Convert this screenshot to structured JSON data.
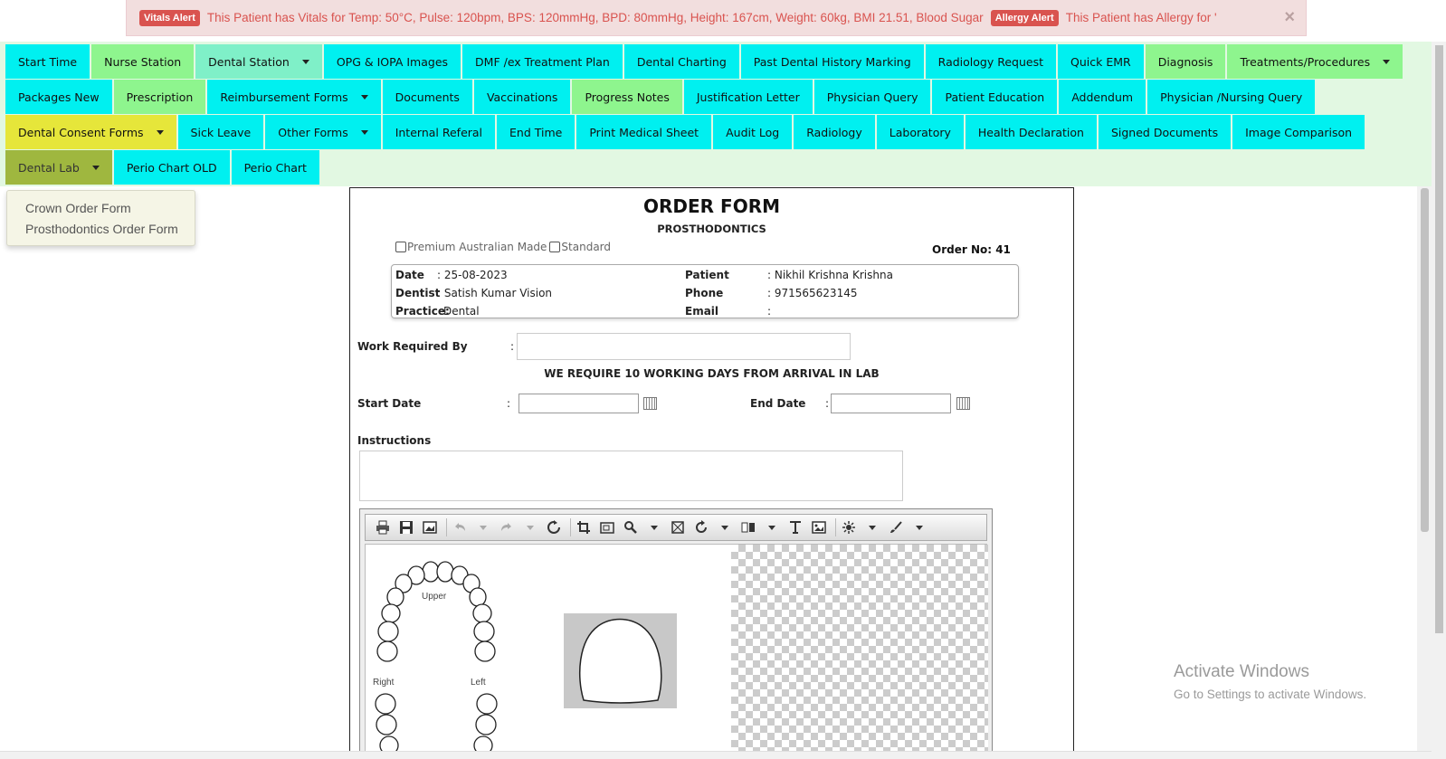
{
  "alerts": {
    "vitals_badge": "Vitals Alert",
    "vitals_text": "This Patient has Vitals for Temp: 50°C, Pulse: 120bpm, BPS: 120mmHg, BPD: 80mmHg, Height: 167cm, Weight: 60kg, BMI 21.51, Blood Sugar",
    "allergy_badge": "Allergy Alert",
    "allergy_text": "This Patient has Allergy for '",
    "close": "×"
  },
  "nav": {
    "row1": [
      {
        "label": "Start Time",
        "color": "cyan",
        "caret": false
      },
      {
        "label": "Nurse Station",
        "color": "green",
        "caret": false
      },
      {
        "label": "Dental Station",
        "color": "mint",
        "caret": true
      },
      {
        "label": "OPG & IOPA Images",
        "color": "cyan",
        "caret": false
      },
      {
        "label": "DMF /ex Treatment Plan",
        "color": "cyan",
        "caret": false
      },
      {
        "label": "Dental Charting",
        "color": "cyan",
        "caret": false
      },
      {
        "label": "Past Dental History Marking",
        "color": "cyan",
        "caret": false
      },
      {
        "label": "Radiology Request",
        "color": "cyan",
        "caret": false
      },
      {
        "label": "Quick EMR",
        "color": "cyan",
        "caret": false
      },
      {
        "label": "Diagnosis",
        "color": "green",
        "caret": false
      },
      {
        "label": "Treatments/Procedures",
        "color": "green",
        "caret": true
      }
    ],
    "row2": [
      {
        "label": "Packages New",
        "color": "cyan",
        "caret": false
      },
      {
        "label": "Prescription",
        "color": "green",
        "caret": false
      },
      {
        "label": "Reimbursement Forms",
        "color": "cyan",
        "caret": true
      },
      {
        "label": "Documents",
        "color": "cyan",
        "caret": false
      },
      {
        "label": "Vaccinations",
        "color": "cyan",
        "caret": false
      },
      {
        "label": "Progress Notes",
        "color": "green",
        "caret": false
      },
      {
        "label": "Justification Letter",
        "color": "cyan",
        "caret": false
      },
      {
        "label": "Physician Query",
        "color": "cyan",
        "caret": false
      },
      {
        "label": "Patient Education",
        "color": "cyan",
        "caret": false
      },
      {
        "label": "Addendum",
        "color": "cyan",
        "caret": false
      },
      {
        "label": "Physician /Nursing Query",
        "color": "cyan",
        "caret": false
      }
    ],
    "row3": [
      {
        "label": "Dental Consent Forms",
        "color": "yellow",
        "caret": true
      },
      {
        "label": "Sick Leave",
        "color": "cyan",
        "caret": false
      },
      {
        "label": "Other Forms",
        "color": "cyan",
        "caret": true
      },
      {
        "label": "Internal Referal",
        "color": "cyan",
        "caret": false
      },
      {
        "label": "End Time",
        "color": "cyan",
        "caret": false
      },
      {
        "label": "Print Medical Sheet",
        "color": "cyan",
        "caret": false
      },
      {
        "label": "Audit Log",
        "color": "cyan",
        "caret": false
      },
      {
        "label": "Radiology",
        "color": "cyan",
        "caret": false
      },
      {
        "label": "Laboratory",
        "color": "cyan",
        "caret": false
      },
      {
        "label": "Health Declaration",
        "color": "cyan",
        "caret": false
      },
      {
        "label": "Signed Documents",
        "color": "cyan",
        "caret": false
      },
      {
        "label": "Image Comparison",
        "color": "cyan",
        "caret": false
      }
    ],
    "row4": [
      {
        "label": "Dental Lab",
        "color": "olive",
        "caret": true
      },
      {
        "label": "Perio Chart OLD",
        "color": "cyan",
        "caret": false
      },
      {
        "label": "Perio Chart",
        "color": "cyan",
        "caret": false
      }
    ]
  },
  "dropdown": {
    "items": [
      "Crown Order Form",
      "Prosthodontics Order Form"
    ]
  },
  "form": {
    "title": "ORDER FORM",
    "subtitle": "PROSTHODONTICS",
    "option_premium": "Premium Australian Made",
    "option_standard": "Standard",
    "order_no": "Order No: 41",
    "date_label": "Date",
    "date_value": ": 25-08-2023",
    "dentist_label": "Dentist",
    "dentist_value": ": Satish Kumar Vision",
    "practice_label": "Practice:",
    "practice_value": "Dental",
    "patient_label": "Patient",
    "patient_value": ": Nikhil Krishna Krishna",
    "phone_label": "Phone",
    "phone_value": ": 971565623145",
    "email_label": "Email",
    "email_value": ":",
    "work_required_label": "Work Required By",
    "colon": ":",
    "work_note": "WE REQUIRE 10 WORKING DAYS FROM ARRIVAL IN LAB",
    "start_date_label": "Start Date",
    "end_date_label": "End Date",
    "instructions_label": "Instructions"
  },
  "editor": {
    "tools": [
      "print-icon",
      "save-icon",
      "save-as-icon",
      "undo-icon",
      "redo-icon",
      "reset-icon",
      "crop-icon",
      "resize-icon",
      "zoom-icon",
      "flip-icon",
      "rotate-icon",
      "compare-icon",
      "text-icon",
      "image-icon",
      "filter-icon",
      "draw-icon"
    ],
    "label_upper": "Upper",
    "label_right": "Right",
    "label_left": "Left"
  },
  "watermark": {
    "line1": "Activate Windows",
    "line2": "Go to Settings to activate Windows."
  }
}
